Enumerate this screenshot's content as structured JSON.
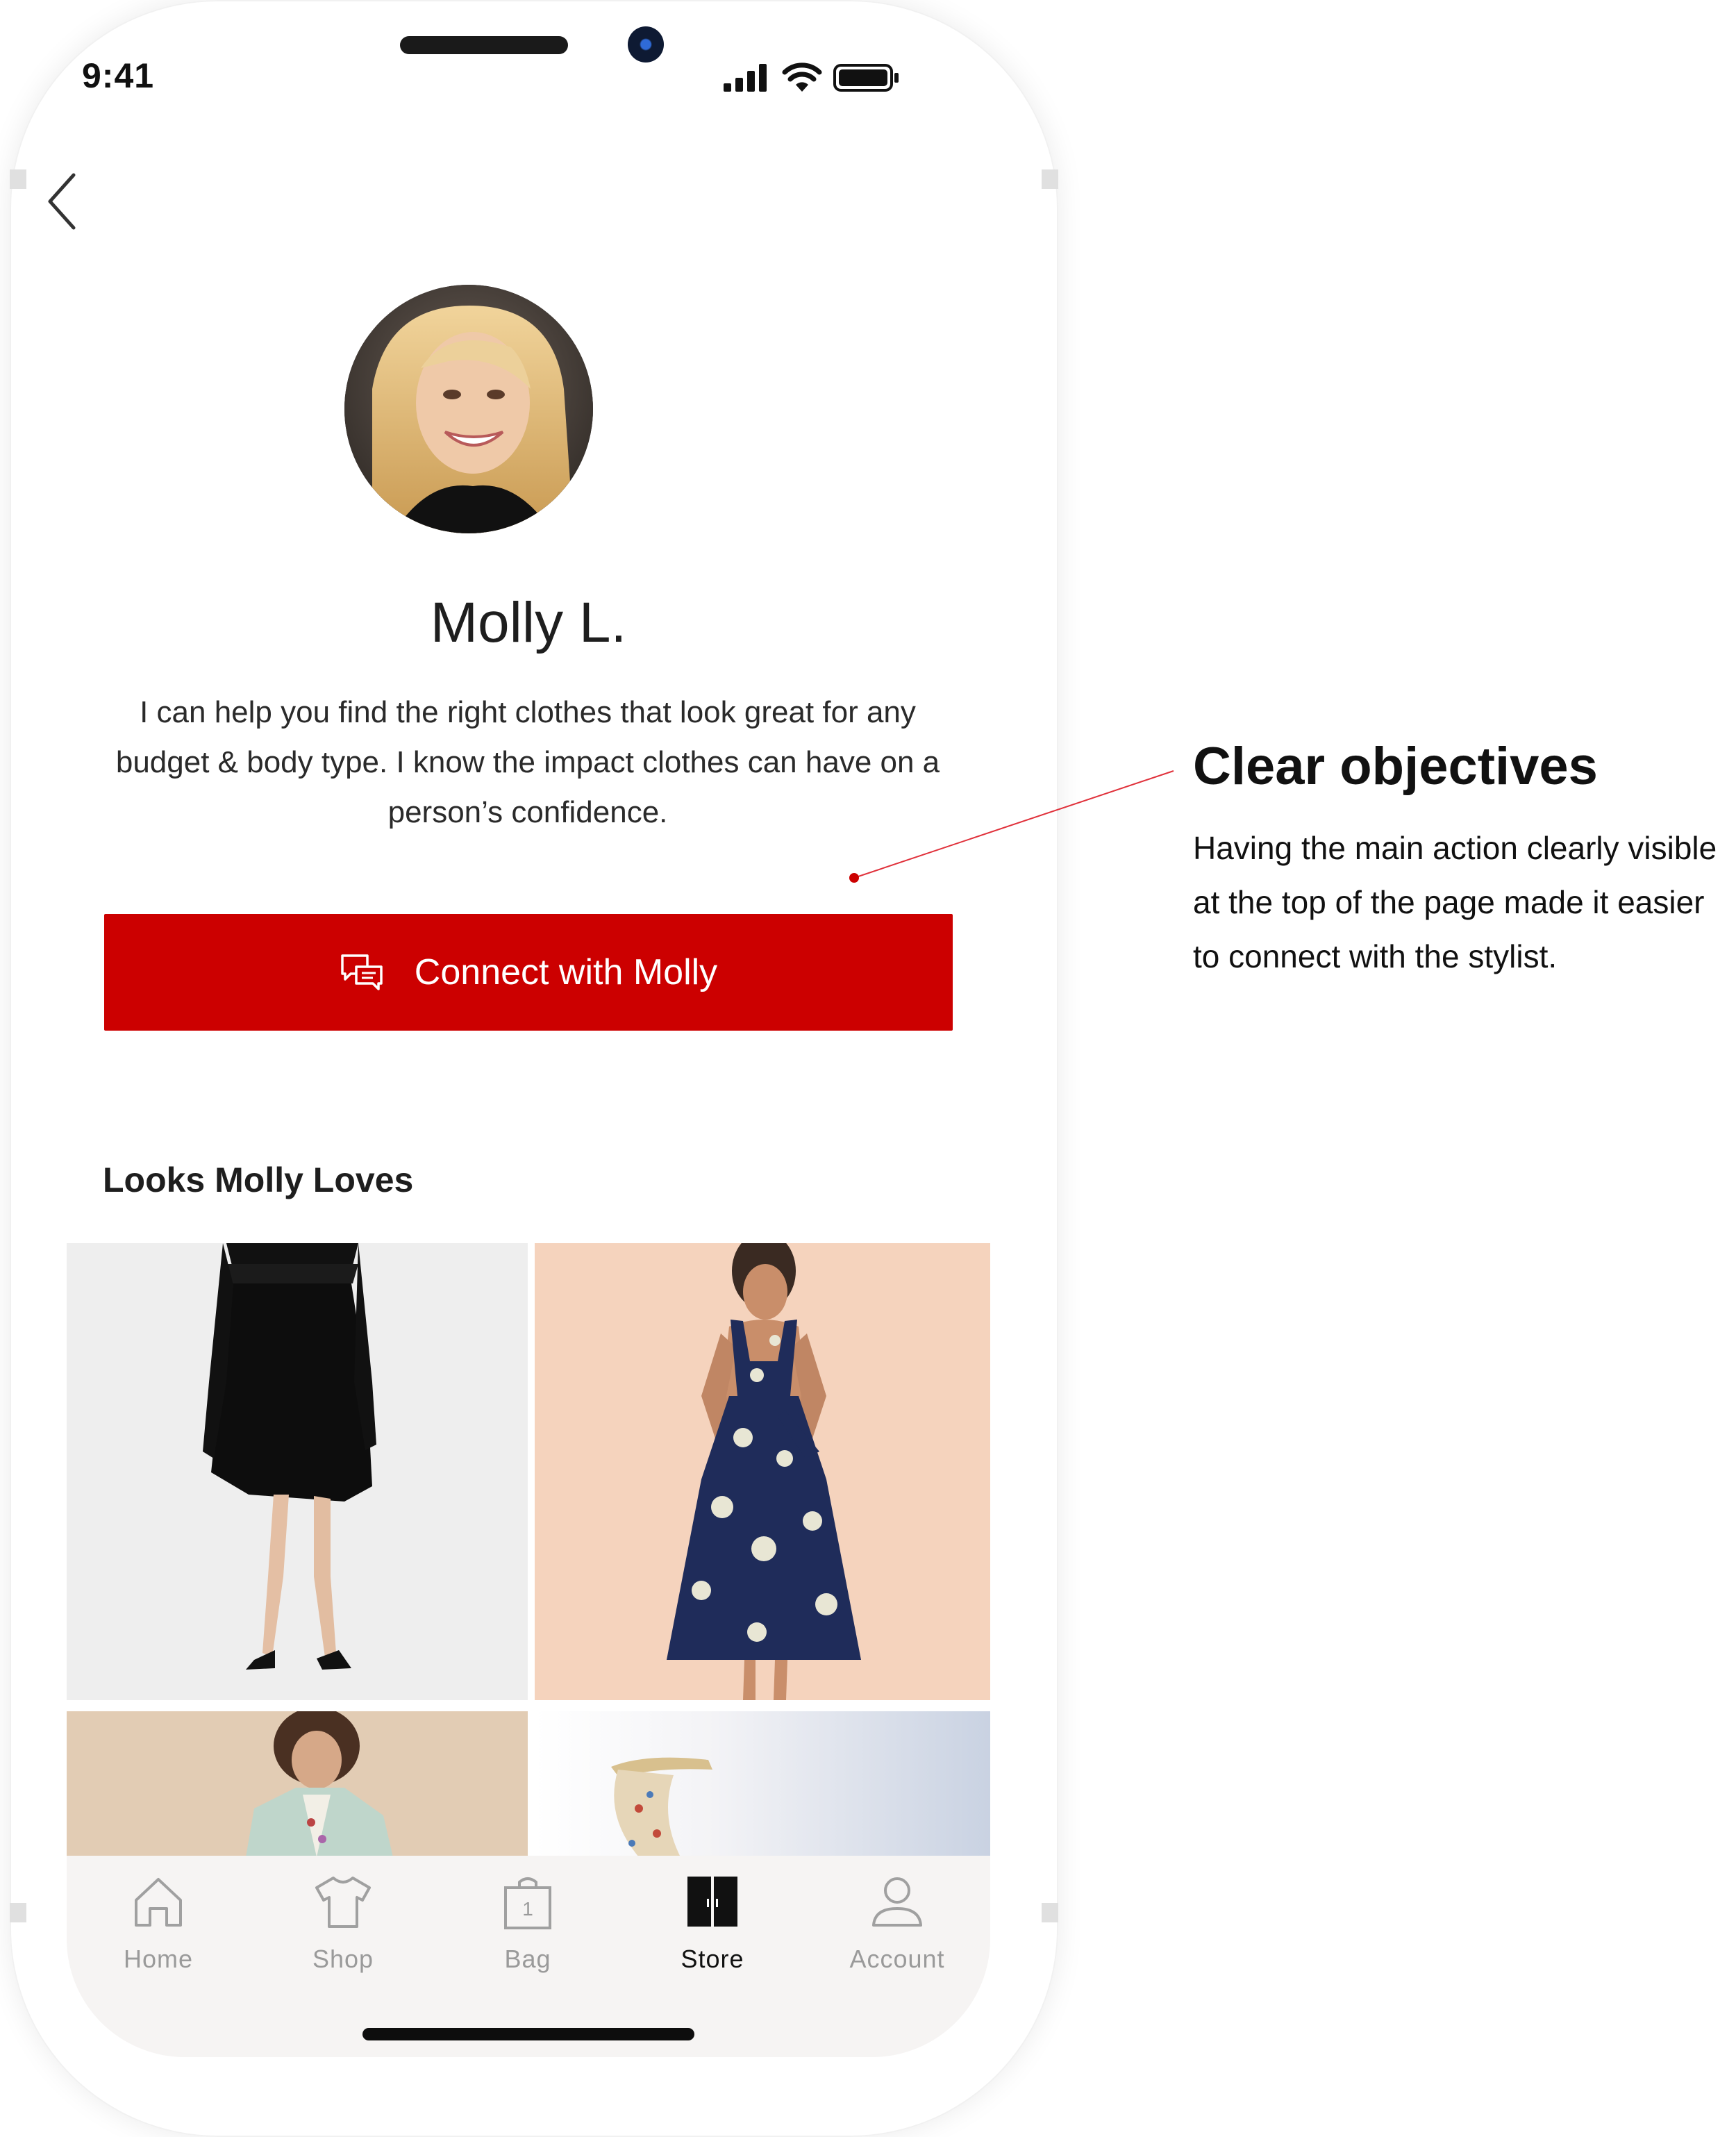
{
  "status_bar": {
    "time": "9:41",
    "icons": [
      "signal-icon",
      "wifi-icon",
      "battery-icon"
    ]
  },
  "nav": {
    "back_icon": "chevron-left-icon"
  },
  "profile": {
    "name": "Molly L.",
    "bio": "I can help you find the right clothes that look great for any budget & body type.  I know the impact clothes can have on a person’s confidence."
  },
  "cta": {
    "label": "Connect with Molly",
    "icon": "chat-bubbles-icon",
    "color": "#cc0000"
  },
  "looks": {
    "title": "Looks Molly Loves",
    "items": [
      {
        "name": "black-wrap-skirt-look"
      },
      {
        "name": "navy-floral-halter-dress-look"
      },
      {
        "name": "mint-blazer-look"
      },
      {
        "name": "embellished-sandal-look"
      }
    ]
  },
  "tabbar": {
    "tabs": [
      {
        "label": "Home",
        "icon": "home-icon",
        "active": false
      },
      {
        "label": "Shop",
        "icon": "tshirt-icon",
        "active": false
      },
      {
        "label": "Bag",
        "icon": "bag-icon",
        "badge": "1",
        "active": false
      },
      {
        "label": "Store",
        "icon": "store-doors-icon",
        "active": true
      },
      {
        "label": "Account",
        "icon": "person-icon",
        "active": false
      }
    ]
  },
  "annotation": {
    "title": "Clear objectives",
    "body": "Having the main action clearly visible at the top of the page made it easier to connect with the stylist.",
    "line_color": "#e0303a"
  }
}
